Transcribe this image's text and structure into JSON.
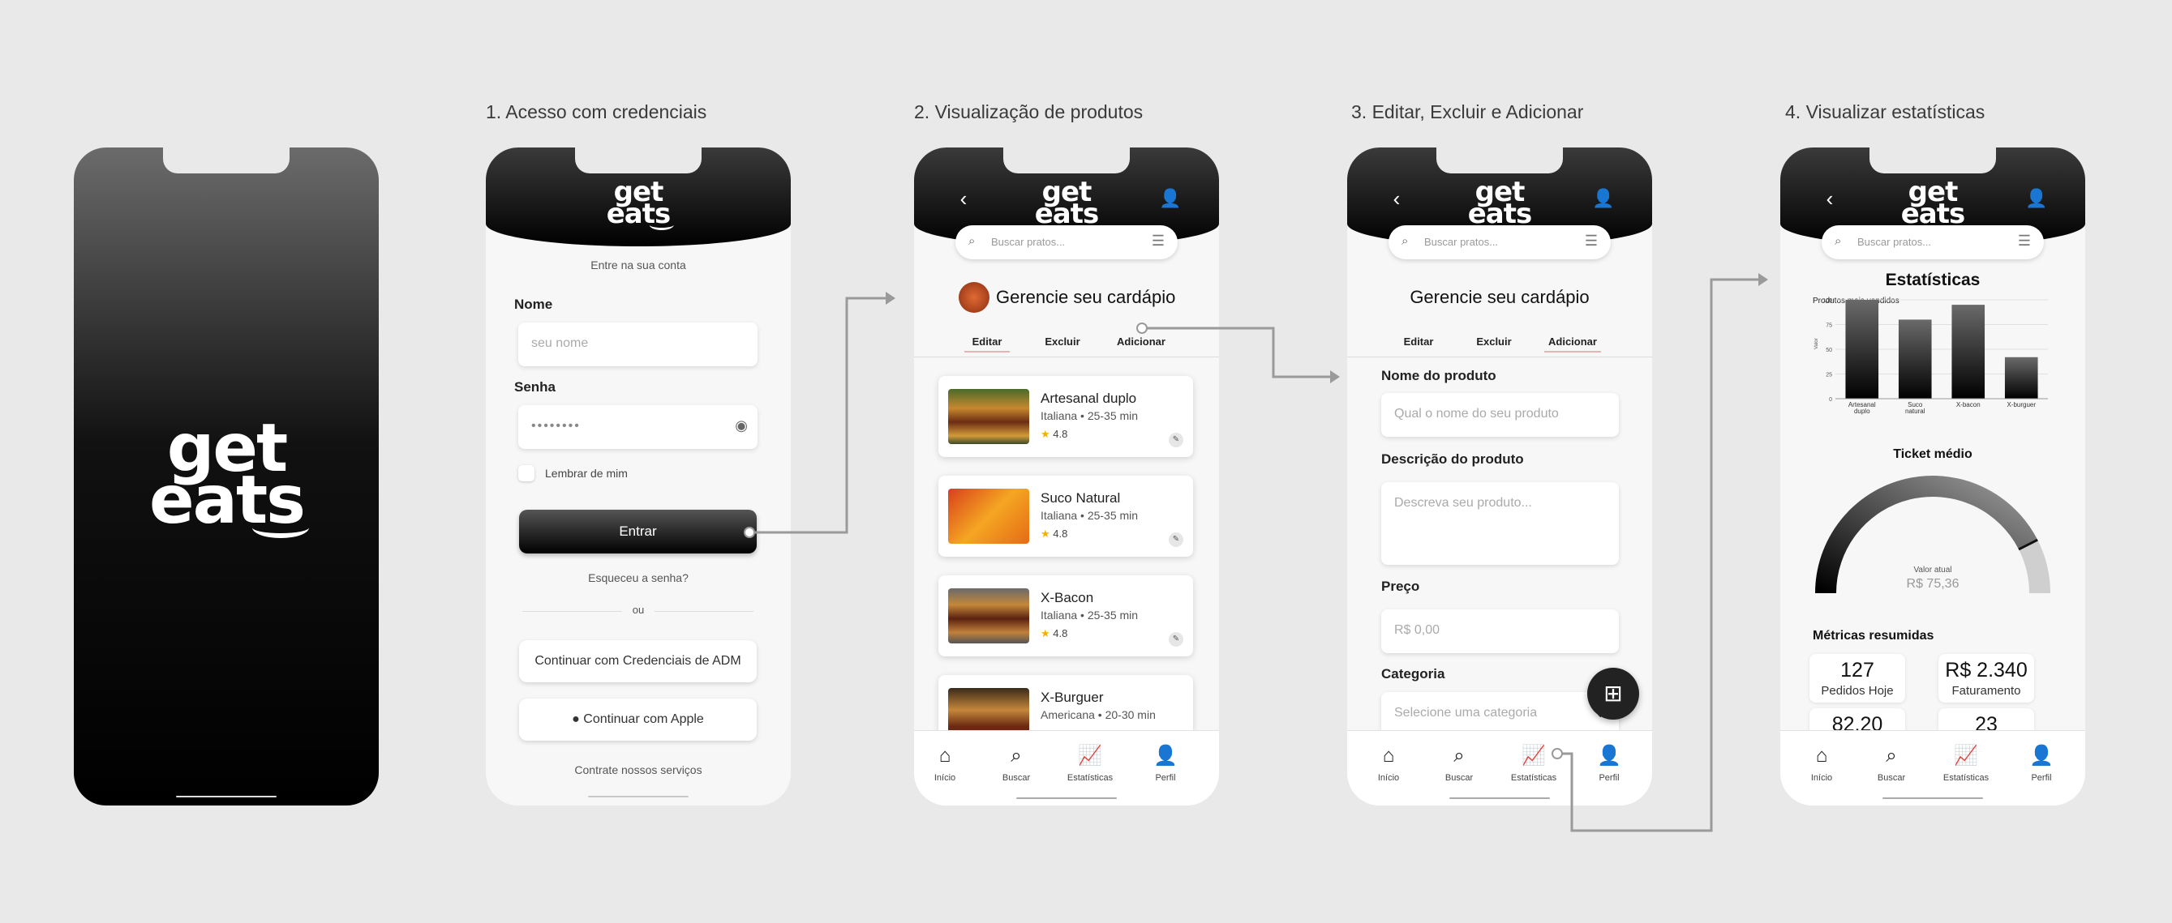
{
  "app": {
    "logo_line1": "get",
    "logo_line2": "eats"
  },
  "steps": {
    "s1": "1. Acesso com credenciais",
    "s2": "2. Visualização de produtos",
    "s3": "3. Editar, Excluir e Adicionar",
    "s4": "4. Visualizar estatísticas"
  },
  "login": {
    "subtitle": "Entre na sua conta",
    "name_label": "Nome",
    "name_placeholder": "seu nome",
    "password_label": "Senha",
    "password_value": "••••••••",
    "remember": "Lembrar de mim",
    "submit": "Entrar",
    "forgot": "Esqueceu a senha?",
    "or": "ou",
    "adm": "Continuar com Credenciais de ADM",
    "apple": "Continuar com Apple",
    "hire": "Contrate nossos serviços"
  },
  "search": {
    "placeholder": "Buscar pratos..."
  },
  "menu": {
    "title": "Gerencie seu cardápio",
    "tabs": [
      "Editar",
      "Excluir",
      "Adicionar"
    ]
  },
  "products": [
    {
      "name": "Artesanal duplo",
      "meta": "Italiana • 25-35 min",
      "rating": "4.8"
    },
    {
      "name": "Suco Natural",
      "meta": "Italiana • 25-35 min",
      "rating": "4.8"
    },
    {
      "name": "X-Bacon",
      "meta": "Italiana • 25-35 min",
      "rating": "4.8"
    },
    {
      "name": "X-Burguer",
      "meta": "Americana • 20-30 min",
      "rating": ""
    }
  ],
  "form": {
    "name_label": "Nome do produto",
    "name_placeholder": "Qual o nome do seu produto",
    "desc_label": "Descrição do produto",
    "desc_placeholder": "Descreva seu produto...",
    "price_label": "Preço",
    "price_placeholder": "R$ 0,00",
    "cat_label": "Categoria",
    "cat_placeholder": "Selecione uma categoria"
  },
  "nav": [
    "Início",
    "Buscar",
    "Estatísticas",
    "Perfil"
  ],
  "stats": {
    "title": "Estatísticas",
    "chart_title": "Produtos mais vendidos",
    "gauge_title": "Ticket médio",
    "gauge_label": "Valor atual",
    "gauge_value": "R$ 75,36",
    "summary_title": "Métricas resumidas",
    "summary": [
      {
        "value": "127",
        "label": "Pedidos Hoje"
      },
      {
        "value": "R$ 2.340",
        "label": "Faturamento"
      },
      {
        "value": "82,20",
        "label": ""
      },
      {
        "value": "23",
        "label": ""
      }
    ]
  },
  "chart_data": {
    "type": "bar",
    "title": "Produtos mais vendidos",
    "categories": [
      "Artesanal duplo",
      "Suco natural",
      "X-bacon",
      "X-burguer"
    ],
    "values": [
      100,
      80,
      95,
      42
    ],
    "ylabel": "Valor",
    "ylim": [
      0,
      100
    ],
    "yticks": [
      0,
      25,
      50,
      75,
      100
    ],
    "grid": true
  },
  "gauge_data": {
    "fraction": 0.85
  },
  "colors": {
    "accent_tab": "#e7b3b3",
    "star": "#f2b100",
    "bar_dark": "#111111"
  }
}
